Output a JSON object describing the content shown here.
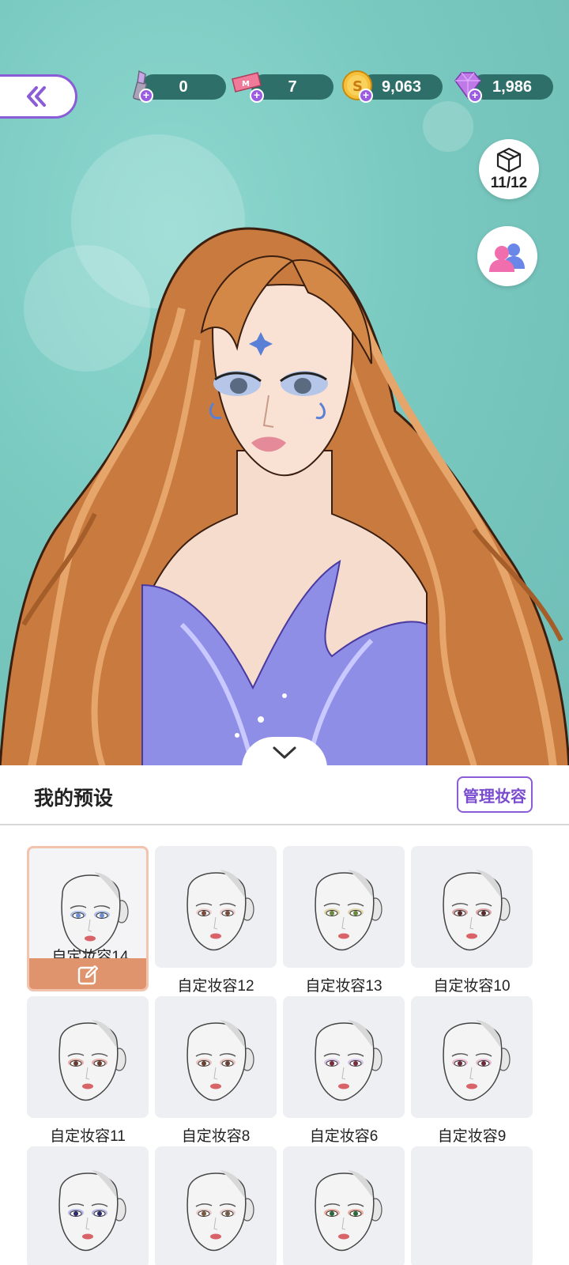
{
  "resources": [
    {
      "icon": "lipstick-icon",
      "value": "0"
    },
    {
      "icon": "ticket-icon",
      "value": "7"
    },
    {
      "icon": "gold-coin-icon",
      "value": "9,063"
    },
    {
      "icon": "diamond-gem-icon",
      "value": "1,986"
    }
  ],
  "wardrobe": {
    "icon": "box-icon",
    "count": "11/12"
  },
  "friends": {
    "icon": "friends-icon"
  },
  "panel": {
    "title": "我的预设",
    "manage_label": "管理妆容"
  },
  "presets": [
    {
      "label": "自定妆容14",
      "selected": true,
      "eye": "#6c8fd0",
      "accent": "#5b7fd6"
    },
    {
      "label": "自定妆容12",
      "eye": "#7a4a3a",
      "accent": "#e7a3a3"
    },
    {
      "label": "自定妆容13",
      "eye": "#6a8a3a",
      "accent": "#c9b24e"
    },
    {
      "label": "自定妆容10",
      "eye": "#5a2a2a",
      "accent": "#c04646"
    },
    {
      "label": "自定妆容11",
      "eye": "#6a3a2a",
      "accent": "#d05a4a"
    },
    {
      "label": "自定妆容8",
      "eye": "#6a4030",
      "accent": "#e08a7a"
    },
    {
      "label": "自定妆容6",
      "eye": "#7a2a3a",
      "accent": "#b98ad8"
    },
    {
      "label": "自定妆容9",
      "eye": "#6a2a3a",
      "accent": "#e07aa8"
    },
    {
      "label": "",
      "eye": "#2a2a6a",
      "accent": "#6a6ad0"
    },
    {
      "label": "",
      "eye": "#7a5a40",
      "accent": "#e0a090"
    },
    {
      "label": "",
      "eye": "#2a6a3a",
      "accent": "#e05a3a"
    },
    {
      "label": "",
      "empty": true
    }
  ],
  "colors": {
    "accent": "#8a5cd8",
    "teal_bg": "#79c9c0",
    "selected_bar": "#e0946e"
  }
}
